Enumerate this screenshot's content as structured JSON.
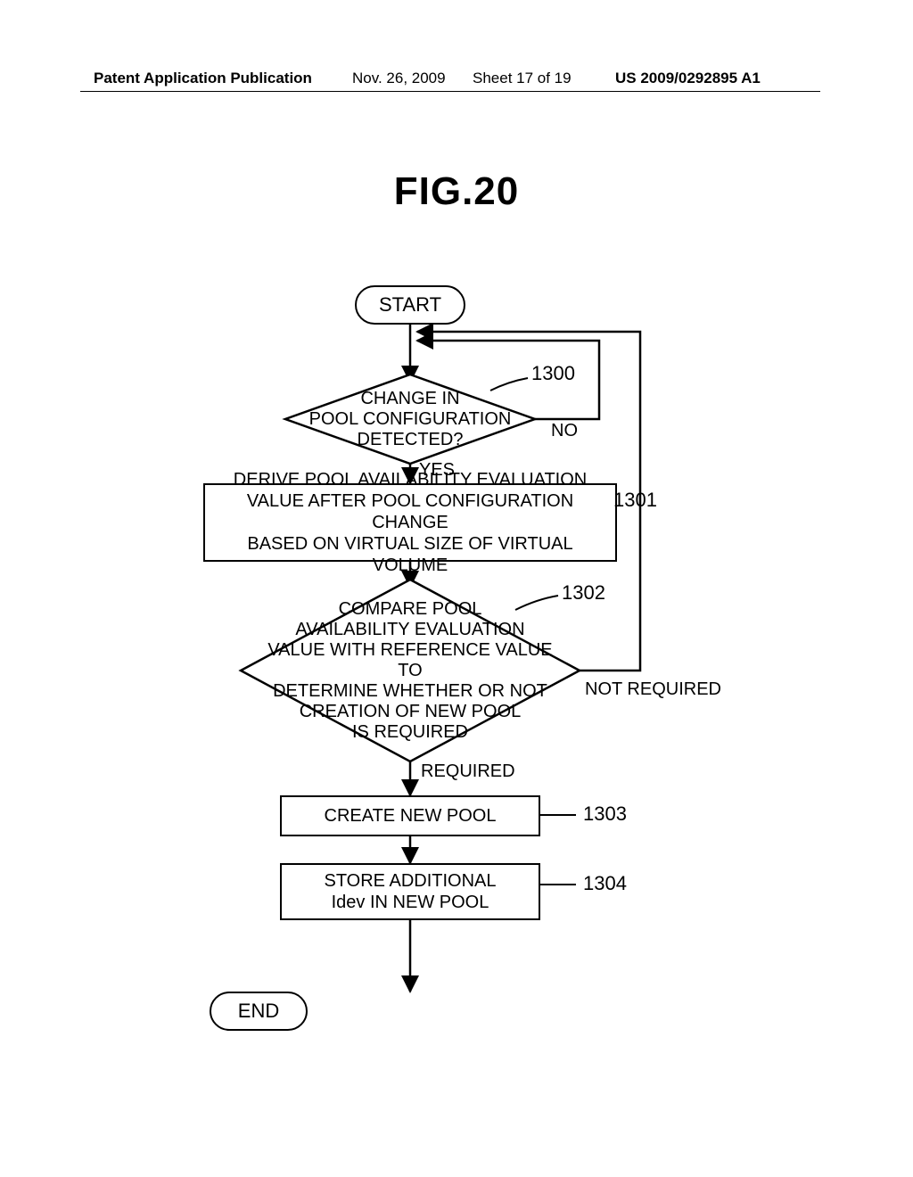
{
  "header": {
    "left": "Patent Application Publication",
    "date": "Nov. 26, 2009",
    "sheet": "Sheet 17 of 19",
    "pubno": "US 2009/0292895 A1"
  },
  "figure": {
    "title": "FIG.20"
  },
  "nodes": {
    "start": "START",
    "d1300": "CHANGE IN\nPOOL CONFIGURATION\nDETECTED?",
    "p1301": "DERIVE POOL AVAILABILITY EVALUATION\nVALUE AFTER POOL CONFIGURATION CHANGE\nBASED ON VIRTUAL SIZE OF VIRTUAL VOLUME",
    "d1302": "COMPARE POOL\nAVAILABILITY EVALUATION\nVALUE WITH REFERENCE VALUE TO\nDETERMINE WHETHER OR NOT\nCREATION OF NEW POOL\nIS REQUIRED",
    "p1303": "CREATE NEW POOL",
    "p1304": "STORE ADDITIONAL\nIdev IN NEW POOL",
    "end": "END"
  },
  "edges": {
    "d1300_no": "NO",
    "d1300_yes": "YES",
    "d1302_notreq": "NOT REQUIRED",
    "d1302_req": "REQUIRED"
  },
  "refs": {
    "r1300": "1300",
    "r1301": "1301",
    "r1302": "1302",
    "r1303": "1303",
    "r1304": "1304"
  }
}
